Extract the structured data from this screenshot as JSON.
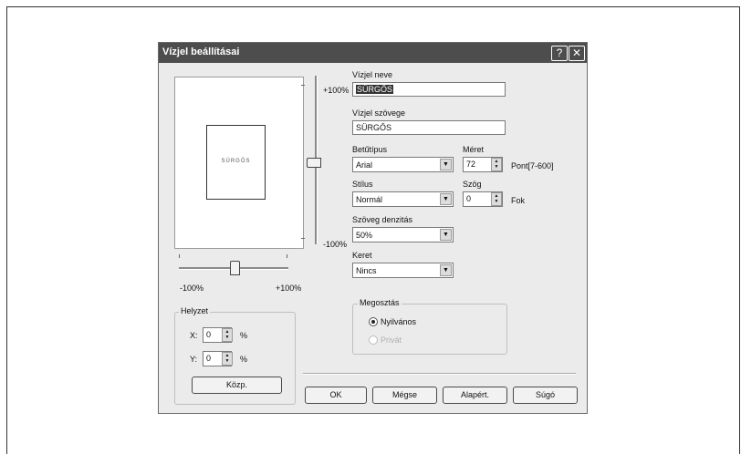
{
  "dialog": {
    "title": "Vízjel beállításai",
    "help_btn": "?",
    "close_btn": "✕"
  },
  "preview": {
    "watermark_text": "SÜRGŐS",
    "vslider_top": "+100%",
    "vslider_bottom": "-100%",
    "hslider_left": "-100%",
    "hslider_right": "+100%"
  },
  "fields": {
    "name_label": "Vízjel neve",
    "name_value": "SÜRGŐS",
    "text_label": "Vízjel szövege",
    "text_value": "SÜRGŐS",
    "font_label": "Betűtípus",
    "font_value": "Arial",
    "size_label": "Méret",
    "size_value": "72",
    "size_unit": "Pont[7-600]",
    "style_label": "Stílus",
    "style_value": "Normál",
    "angle_label": "Szög",
    "angle_value": "0",
    "angle_unit": "Fok",
    "density_label": "Szöveg denzitás",
    "density_value": "50%",
    "frame_label": "Keret",
    "frame_value": "Nincs"
  },
  "position": {
    "group_title": "Helyzet",
    "x_label": "X:",
    "x_value": "0",
    "x_unit": "%",
    "y_label": "Y:",
    "y_value": "0",
    "y_unit": "%",
    "center_button": "Közp."
  },
  "sharing": {
    "group_title": "Megosztás",
    "public_label": "Nyilvános",
    "public_checked": true,
    "private_label": "Privát",
    "private_enabled": false
  },
  "buttons": {
    "ok": "OK",
    "cancel": "Mégse",
    "default": "Alapért.",
    "help": "Súgó"
  }
}
